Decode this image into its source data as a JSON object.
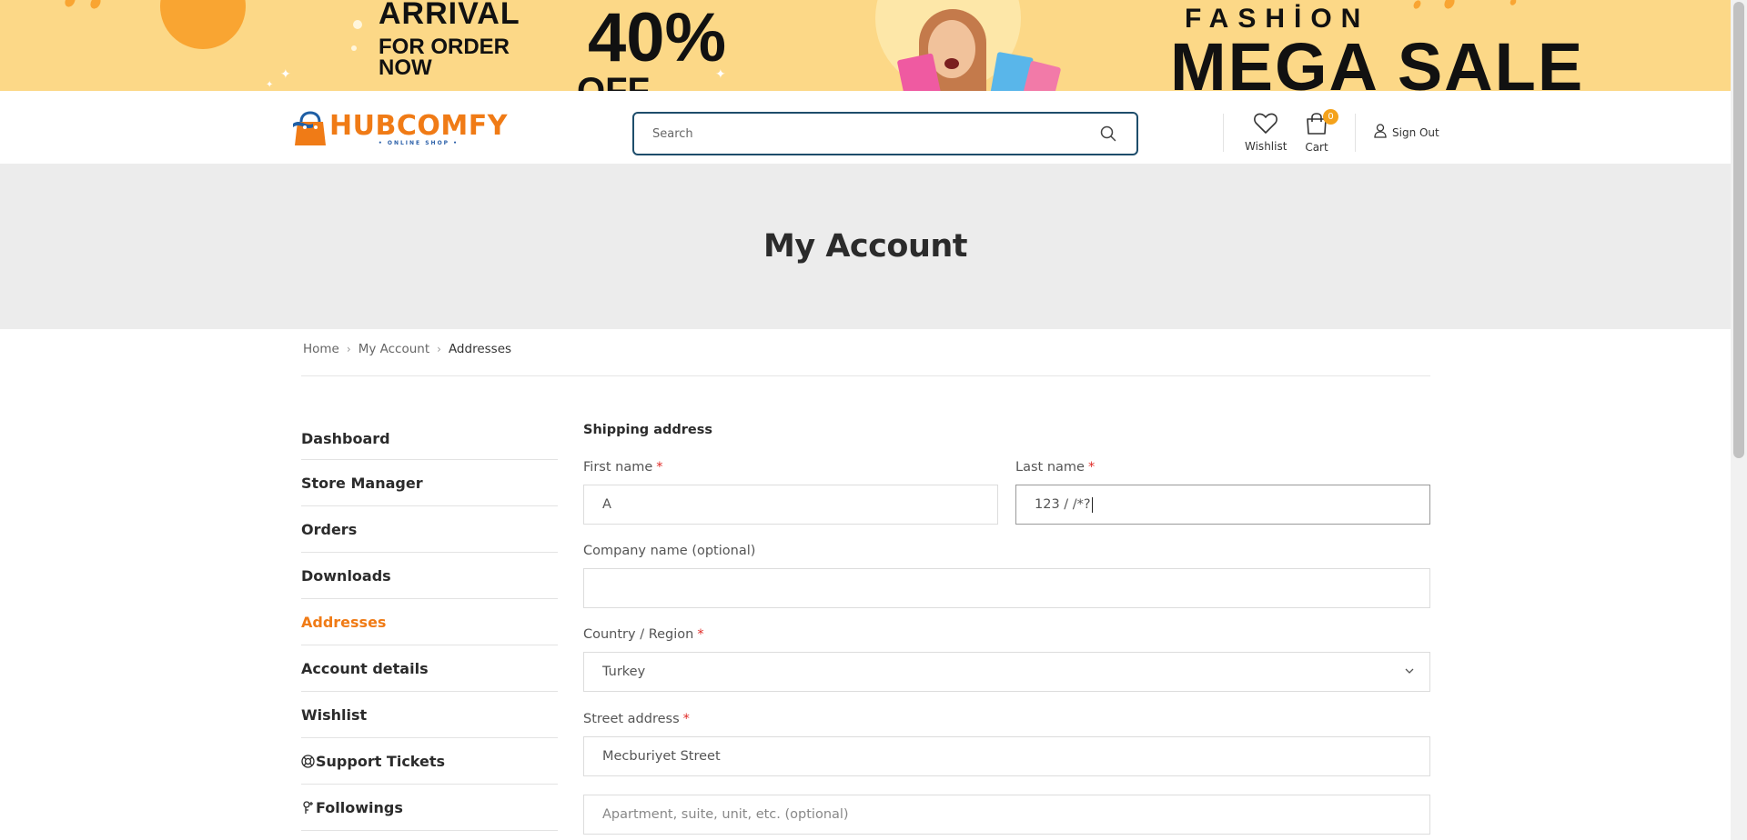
{
  "banner": {
    "arrival": "ARRİVAL",
    "for_order": "FOR ORDER",
    "now": "NOW",
    "percent": "40%",
    "off": "OFF",
    "fashion": "FASHİON",
    "mega_sale": "MEGA SALE",
    "accent_color": "#fcd887"
  },
  "header": {
    "logo_brand": "HUBCOMFY",
    "logo_tagline": "• ONLINE SHOP •",
    "search_placeholder": "Search",
    "wishlist_label": "Wishlist",
    "cart_label": "Cart",
    "cart_count": "0",
    "signout_label": "Sign Out"
  },
  "page_title": "My Account",
  "breadcrumb": {
    "items": [
      "Home",
      "My Account",
      "Addresses"
    ]
  },
  "account_nav": {
    "items": [
      {
        "label": "Dashboard"
      },
      {
        "label": "Store Manager"
      },
      {
        "label": "Orders"
      },
      {
        "label": "Downloads"
      },
      {
        "label": "Addresses",
        "active": true
      },
      {
        "label": "Account details"
      },
      {
        "label": "Wishlist"
      },
      {
        "label": "Support Tickets",
        "icon": "lifebuoy-icon"
      },
      {
        "label": "Followings",
        "icon": "follow-icon"
      }
    ],
    "active_color": "#f07b16"
  },
  "form": {
    "section_title": "Shipping address",
    "first_name": {
      "label": "First name",
      "required_mark": "*",
      "value": "A"
    },
    "last_name": {
      "label": "Last name",
      "required_mark": "*",
      "value": "123 / /*?"
    },
    "company": {
      "label": "Company name (optional)",
      "value": ""
    },
    "country": {
      "label": "Country / Region",
      "required_mark": "*",
      "value": "Turkey"
    },
    "street": {
      "label": "Street address",
      "required_mark": "*",
      "value": "Mecburiyet Street"
    },
    "apartment": {
      "placeholder": "Apartment, suite, unit, etc. (optional)"
    }
  }
}
